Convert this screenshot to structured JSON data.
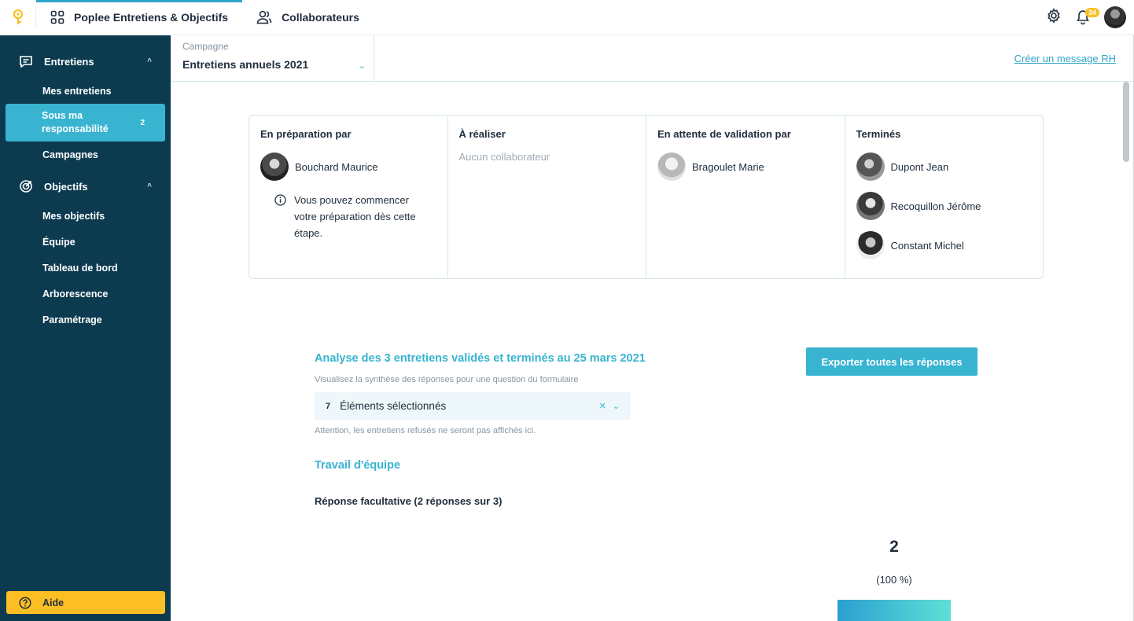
{
  "topbar": {
    "app_tab": "Poplee Entretiens & Objectifs",
    "people_tab": "Collaborateurs",
    "notification_count": "34"
  },
  "sidebar": {
    "entretiens": {
      "label": "Entretiens",
      "items": [
        {
          "label": "Mes entretiens"
        },
        {
          "label": "Sous ma responsabilité",
          "count": "2"
        },
        {
          "label": "Campagnes"
        }
      ]
    },
    "objectifs": {
      "label": "Objectifs",
      "items": [
        {
          "label": "Mes objectifs"
        },
        {
          "label": "Équipe"
        },
        {
          "label": "Tableau de bord"
        },
        {
          "label": "Arborescence"
        },
        {
          "label": "Paramétrage"
        }
      ]
    },
    "help": "Aide"
  },
  "campaign": {
    "label": "Campagne",
    "value": "Entretiens annuels 2021",
    "hr_link": "Créer un message RH"
  },
  "board": {
    "col1": {
      "title": "En préparation par",
      "person": "Bouchard Maurice",
      "note": "Vous pouvez commencer votre préparation dès cette étape."
    },
    "col2": {
      "title": "À réaliser",
      "empty": "Aucun collaborateur"
    },
    "col3": {
      "title": "En attente de validation par",
      "person": "Bragoulet Marie"
    },
    "col4": {
      "title": "Terminés",
      "people": [
        "Dupont Jean",
        "Recoquillon Jérôme",
        "Constant Michel"
      ]
    }
  },
  "analysis": {
    "title": "Analyse des 3 entretiens validés et terminés au 25 mars 2021",
    "subtitle": "Visualisez la synthèse des réponses pour une question du formulaire",
    "selected_count": "7",
    "selected_label": "Éléments sélectionnés",
    "warning": "Attention, les entretiens refusés ne seront pas affichés ici.",
    "export": "Exporter toutes les réponses",
    "section": "Travail d'équipe",
    "question": "Réponse facultative (2 réponses sur 3)",
    "bar_value": "2",
    "bar_percent": "(100 %)",
    "bar_fraction": 1.0
  },
  "colors": {
    "accent": "#38b4d1",
    "sidebar": "#0c3b50",
    "help": "#fbbf24"
  }
}
